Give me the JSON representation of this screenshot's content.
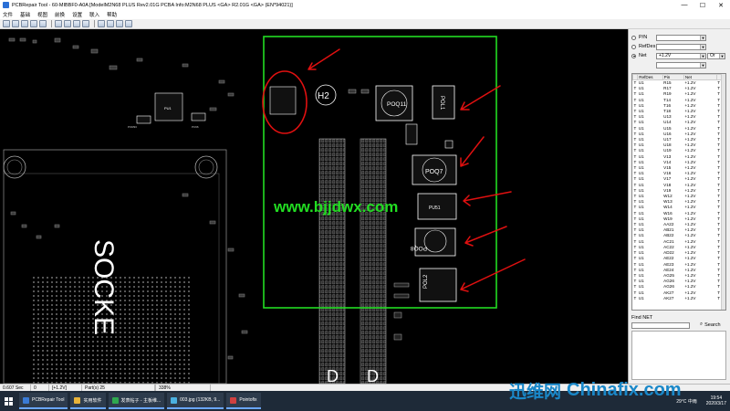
{
  "window": {
    "title": "PCBRepair Tool - 60-MIBBF0-A0A [ModelM2N68 PLUS Rev2.01G PCBA Info:M2N68 PLUS <GA> R2.01G <GA>  (EN*94021)]",
    "controls": {
      "minimize": "—",
      "maximize": "☐",
      "close": "✕"
    }
  },
  "menu": [
    "文件",
    "基础",
    "视图",
    "前换",
    "设置",
    "联入",
    "帮助"
  ],
  "toolbar_count": 14,
  "board": {
    "h2_label": "H2",
    "pol1": "POL1",
    "poq11": "POQ11",
    "poq7": "POQ7",
    "pu_small": "PU51",
    "poq8": "POQ8",
    "pol2": "POL2",
    "url": "www.bjjdwx.com",
    "socket": "SOCKE",
    "d1": "D",
    "d2": "D",
    "chip_pu1": "PU1",
    "small1": "POR93",
    "small2": "PC96"
  },
  "panel": {
    "radios": [
      {
        "label": "P/N",
        "value": "",
        "checked": false
      },
      {
        "label": "RefDes",
        "value": "",
        "checked": false
      },
      {
        "label": "Net",
        "value": "+1.2V",
        "checked": true
      }
    ],
    "or_value": "Or",
    "extra_combo": "",
    "columns": [
      "",
      "RefDes",
      "Pin",
      "Net",
      ""
    ],
    "rows": [
      [
        "T",
        "U1",
        "R15",
        "+1.2V",
        "T"
      ],
      [
        "T",
        "U1",
        "R17",
        "+1.2V",
        "T"
      ],
      [
        "T",
        "U1",
        "R19",
        "+1.2V",
        "T"
      ],
      [
        "T",
        "U1",
        "T14",
        "+1.2V",
        "T"
      ],
      [
        "T",
        "U1",
        "T16",
        "+1.2V",
        "T"
      ],
      [
        "T",
        "U1",
        "T18",
        "+1.2V",
        "T"
      ],
      [
        "T",
        "U1",
        "U13",
        "+1.2V",
        "T"
      ],
      [
        "T",
        "U1",
        "U14",
        "+1.2V",
        "T"
      ],
      [
        "T",
        "U1",
        "U15",
        "+1.2V",
        "T"
      ],
      [
        "T",
        "U1",
        "U16",
        "+1.2V",
        "T"
      ],
      [
        "T",
        "U1",
        "U17",
        "+1.2V",
        "T"
      ],
      [
        "T",
        "U1",
        "U18",
        "+1.2V",
        "T"
      ],
      [
        "T",
        "U1",
        "U19",
        "+1.2V",
        "T"
      ],
      [
        "T",
        "U1",
        "V13",
        "+1.2V",
        "T"
      ],
      [
        "T",
        "U1",
        "V14",
        "+1.2V",
        "T"
      ],
      [
        "T",
        "U1",
        "V15",
        "+1.2V",
        "T"
      ],
      [
        "T",
        "U1",
        "V16",
        "+1.2V",
        "T"
      ],
      [
        "T",
        "U1",
        "V17",
        "+1.2V",
        "T"
      ],
      [
        "T",
        "U1",
        "V18",
        "+1.2V",
        "T"
      ],
      [
        "T",
        "U1",
        "V19",
        "+1.2V",
        "T"
      ],
      [
        "T",
        "U1",
        "W12",
        "+1.2V",
        "T"
      ],
      [
        "T",
        "U1",
        "W13",
        "+1.2V",
        "T"
      ],
      [
        "T",
        "U1",
        "W14",
        "+1.2V",
        "T"
      ],
      [
        "T",
        "U1",
        "W16",
        "+1.2V",
        "T"
      ],
      [
        "T",
        "U1",
        "W19",
        "+1.2V",
        "T"
      ],
      [
        "T",
        "U1",
        "AA22",
        "+1.2V",
        "T"
      ],
      [
        "T",
        "U1",
        "AB21",
        "+1.2V",
        "T"
      ],
      [
        "T",
        "U1",
        "AB22",
        "+1.2V",
        "T"
      ],
      [
        "T",
        "U1",
        "AC21",
        "+1.2V",
        "T"
      ],
      [
        "T",
        "U1",
        "AC22",
        "+1.2V",
        "T"
      ],
      [
        "T",
        "U1",
        "AD22",
        "+1.2V",
        "T"
      ],
      [
        "T",
        "U1",
        "AE22",
        "+1.2V",
        "T"
      ],
      [
        "T",
        "U1",
        "AE23",
        "+1.2V",
        "T"
      ],
      [
        "T",
        "U1",
        "AE24",
        "+1.2V",
        "T"
      ],
      [
        "T",
        "U1",
        "AG25",
        "+1.2V",
        "T"
      ],
      [
        "T",
        "U1",
        "AG26",
        "+1.2V",
        "T"
      ],
      [
        "T",
        "U1",
        "AG26",
        "+1.2V",
        "T"
      ],
      [
        "T",
        "U1",
        "AK27",
        "+1.2V",
        "T"
      ],
      [
        "T",
        "U1",
        "AK27",
        "+1.2V",
        "T"
      ]
    ],
    "find_label": "Find NET",
    "find_value": "",
    "search_label": "Search"
  },
  "status": [
    "0.607 Sec",
    "0",
    "[+1.2V]",
    "Part(s) 25",
    "",
    "338%"
  ],
  "taskbar": {
    "items": [
      {
        "label": "PCBRepair Tool",
        "color": "#3a7bd5"
      },
      {
        "label": "实用软件",
        "color": "#e8b33a"
      },
      {
        "label": "发表帖子 - 主板维...",
        "color": "#2fa84f"
      },
      {
        "label": "003.jpg (132KB, 9...",
        "color": "#4bb0e0"
      },
      {
        "label": "Pointofix",
        "color": "#d04040"
      }
    ],
    "weather": "29°C 中雨",
    "time": "19:54",
    "date": "2020/3/17"
  },
  "watermark": {
    "cn": "迅维网",
    "en": "Chinafix.com"
  },
  "colors": {
    "highlight_box": "#22dd22",
    "annotation": "#e01010",
    "url": "#22dd22"
  }
}
